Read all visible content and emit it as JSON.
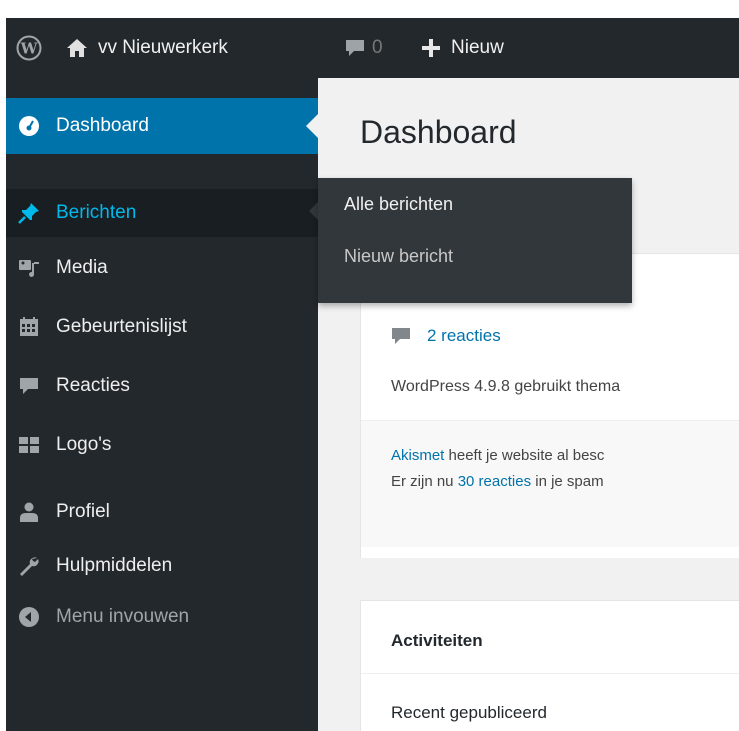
{
  "adminbar": {
    "logo_icon": "wordpress-logo-icon",
    "site_icon": "home-icon",
    "site_name": "vv Nieuwerkerk",
    "comments_icon": "comment-bubble-icon",
    "comments_count": "0",
    "new_icon": "plus-icon",
    "new_label": "Nieuw"
  },
  "sidebar": {
    "items": [
      {
        "label": "Dashboard",
        "icon": "dashboard-gauge-icon",
        "state": "active"
      },
      {
        "label": "Berichten",
        "icon": "pushpin-icon",
        "state": "hover"
      },
      {
        "label": "Media",
        "icon": "media-icon"
      },
      {
        "label": "Gebeurtenislijst",
        "icon": "calendar-icon"
      },
      {
        "label": "Reacties",
        "icon": "comment-bubble-icon"
      },
      {
        "label": "Logo's",
        "icon": "grid-icon"
      },
      {
        "label": "Profiel",
        "icon": "user-icon"
      },
      {
        "label": "Hulpmiddelen",
        "icon": "wrench-icon"
      },
      {
        "label": "Menu invouwen",
        "icon": "collapse-arrow-icon"
      }
    ],
    "flyout": [
      "Alle berichten",
      "Nieuw bericht"
    ]
  },
  "main": {
    "title": "Dashboard",
    "glance_comments": "2 reacties",
    "wp_version_text": "WordPress 4.9.8 gebruikt thema",
    "akismet": {
      "link": "Akismet",
      "line1_rest": " heeft je website al besc",
      "line2_pre": "Er zijn nu ",
      "line2_link": "30 reacties",
      "line2_post": " in je spam"
    },
    "activity_title": "Activiteiten",
    "recent_published": "Recent gepubliceerd"
  },
  "colors": {
    "adminbar_bg": "#23282d",
    "active_bg": "#0073aa",
    "hover_text": "#00b9eb",
    "link": "#0073aa"
  }
}
